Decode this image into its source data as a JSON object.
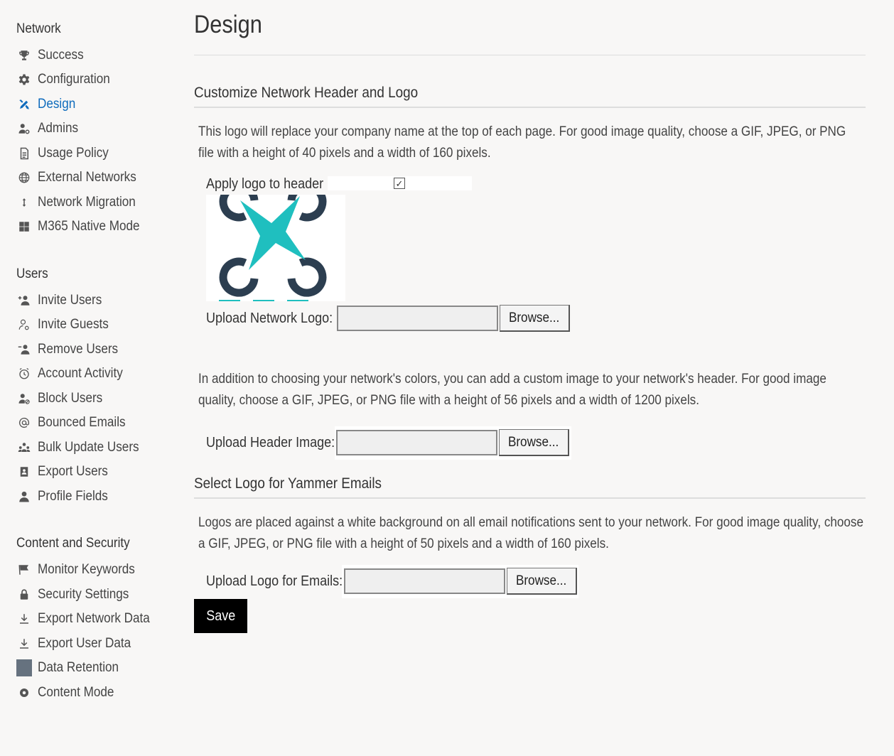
{
  "sidebar": {
    "sections": [
      {
        "heading": "Network",
        "items": [
          {
            "label": "Success",
            "icon": "trophy-icon"
          },
          {
            "label": "Configuration",
            "icon": "gear-icon"
          },
          {
            "label": "Design",
            "icon": "design-tools-icon",
            "active": true
          },
          {
            "label": "Admins",
            "icon": "admin-user-icon"
          },
          {
            "label": "Usage Policy",
            "icon": "document-icon"
          },
          {
            "label": "External Networks",
            "icon": "globe-icon"
          },
          {
            "label": "Network Migration",
            "icon": "migrate-arrows-icon"
          },
          {
            "label": "M365 Native Mode",
            "icon": "windows-grid-icon"
          }
        ]
      },
      {
        "heading": "Users",
        "items": [
          {
            "label": "Invite Users",
            "icon": "add-user-icon"
          },
          {
            "label": "Invite Guests",
            "icon": "guest-user-icon"
          },
          {
            "label": "Remove Users",
            "icon": "remove-user-icon"
          },
          {
            "label": "Account Activity",
            "icon": "clock-icon"
          },
          {
            "label": "Block Users",
            "icon": "block-user-icon"
          },
          {
            "label": "Bounced Emails",
            "icon": "at-sign-icon"
          },
          {
            "label": "Bulk Update Users",
            "icon": "group-users-icon"
          },
          {
            "label": "Export Users",
            "icon": "contact-book-icon"
          },
          {
            "label": "Profile Fields",
            "icon": "user-icon"
          }
        ]
      },
      {
        "heading": "Content and Security",
        "items": [
          {
            "label": "Monitor Keywords",
            "icon": "flag-icon"
          },
          {
            "label": "Security Settings",
            "icon": "lock-icon"
          },
          {
            "label": "Export Network Data",
            "icon": "download-icon"
          },
          {
            "label": "Export User Data",
            "icon": "download-icon"
          },
          {
            "label": "Data Retention",
            "icon": "data-retention-icon"
          },
          {
            "label": "Content Mode",
            "icon": "eye-icon"
          }
        ]
      }
    ]
  },
  "main": {
    "title": "Design",
    "header_logo_section": {
      "title": "Customize Network Header and Logo",
      "description": "This logo will replace your company name at the top of each page. For good image quality, choose a GIF, JPEG, or PNG file with a height of 40 pixels and a width of 160 pixels.",
      "apply_logo_label": "Apply logo to header",
      "apply_logo_checked": true,
      "upload_logo_label": "Upload Network Logo:",
      "browse_label": "Browse...",
      "header_image_description": "In addition to choosing your network's colors, you can add a custom image to your network's header. For good image quality, choose a GIF, JPEG, or PNG file with a height of 56 pixels and a width of 1200 pixels.",
      "upload_header_label": "Upload Header Image:"
    },
    "email_logo_section": {
      "title": "Select Logo for Yammer Emails",
      "description": "Logos are placed against a white background on all email notifications sent to your network. For good image quality, choose a GIF, JPEG, or PNG file with a height of 50 pixels and a width of 160 pixels.",
      "upload_email_logo_label": "Upload Logo for Emails:"
    },
    "save_label": "Save"
  },
  "colors": {
    "accent": "#0f6cbd",
    "logo_teal": "#1fbfbf",
    "logo_dark": "#2c3e50",
    "save_button": "#000000"
  }
}
